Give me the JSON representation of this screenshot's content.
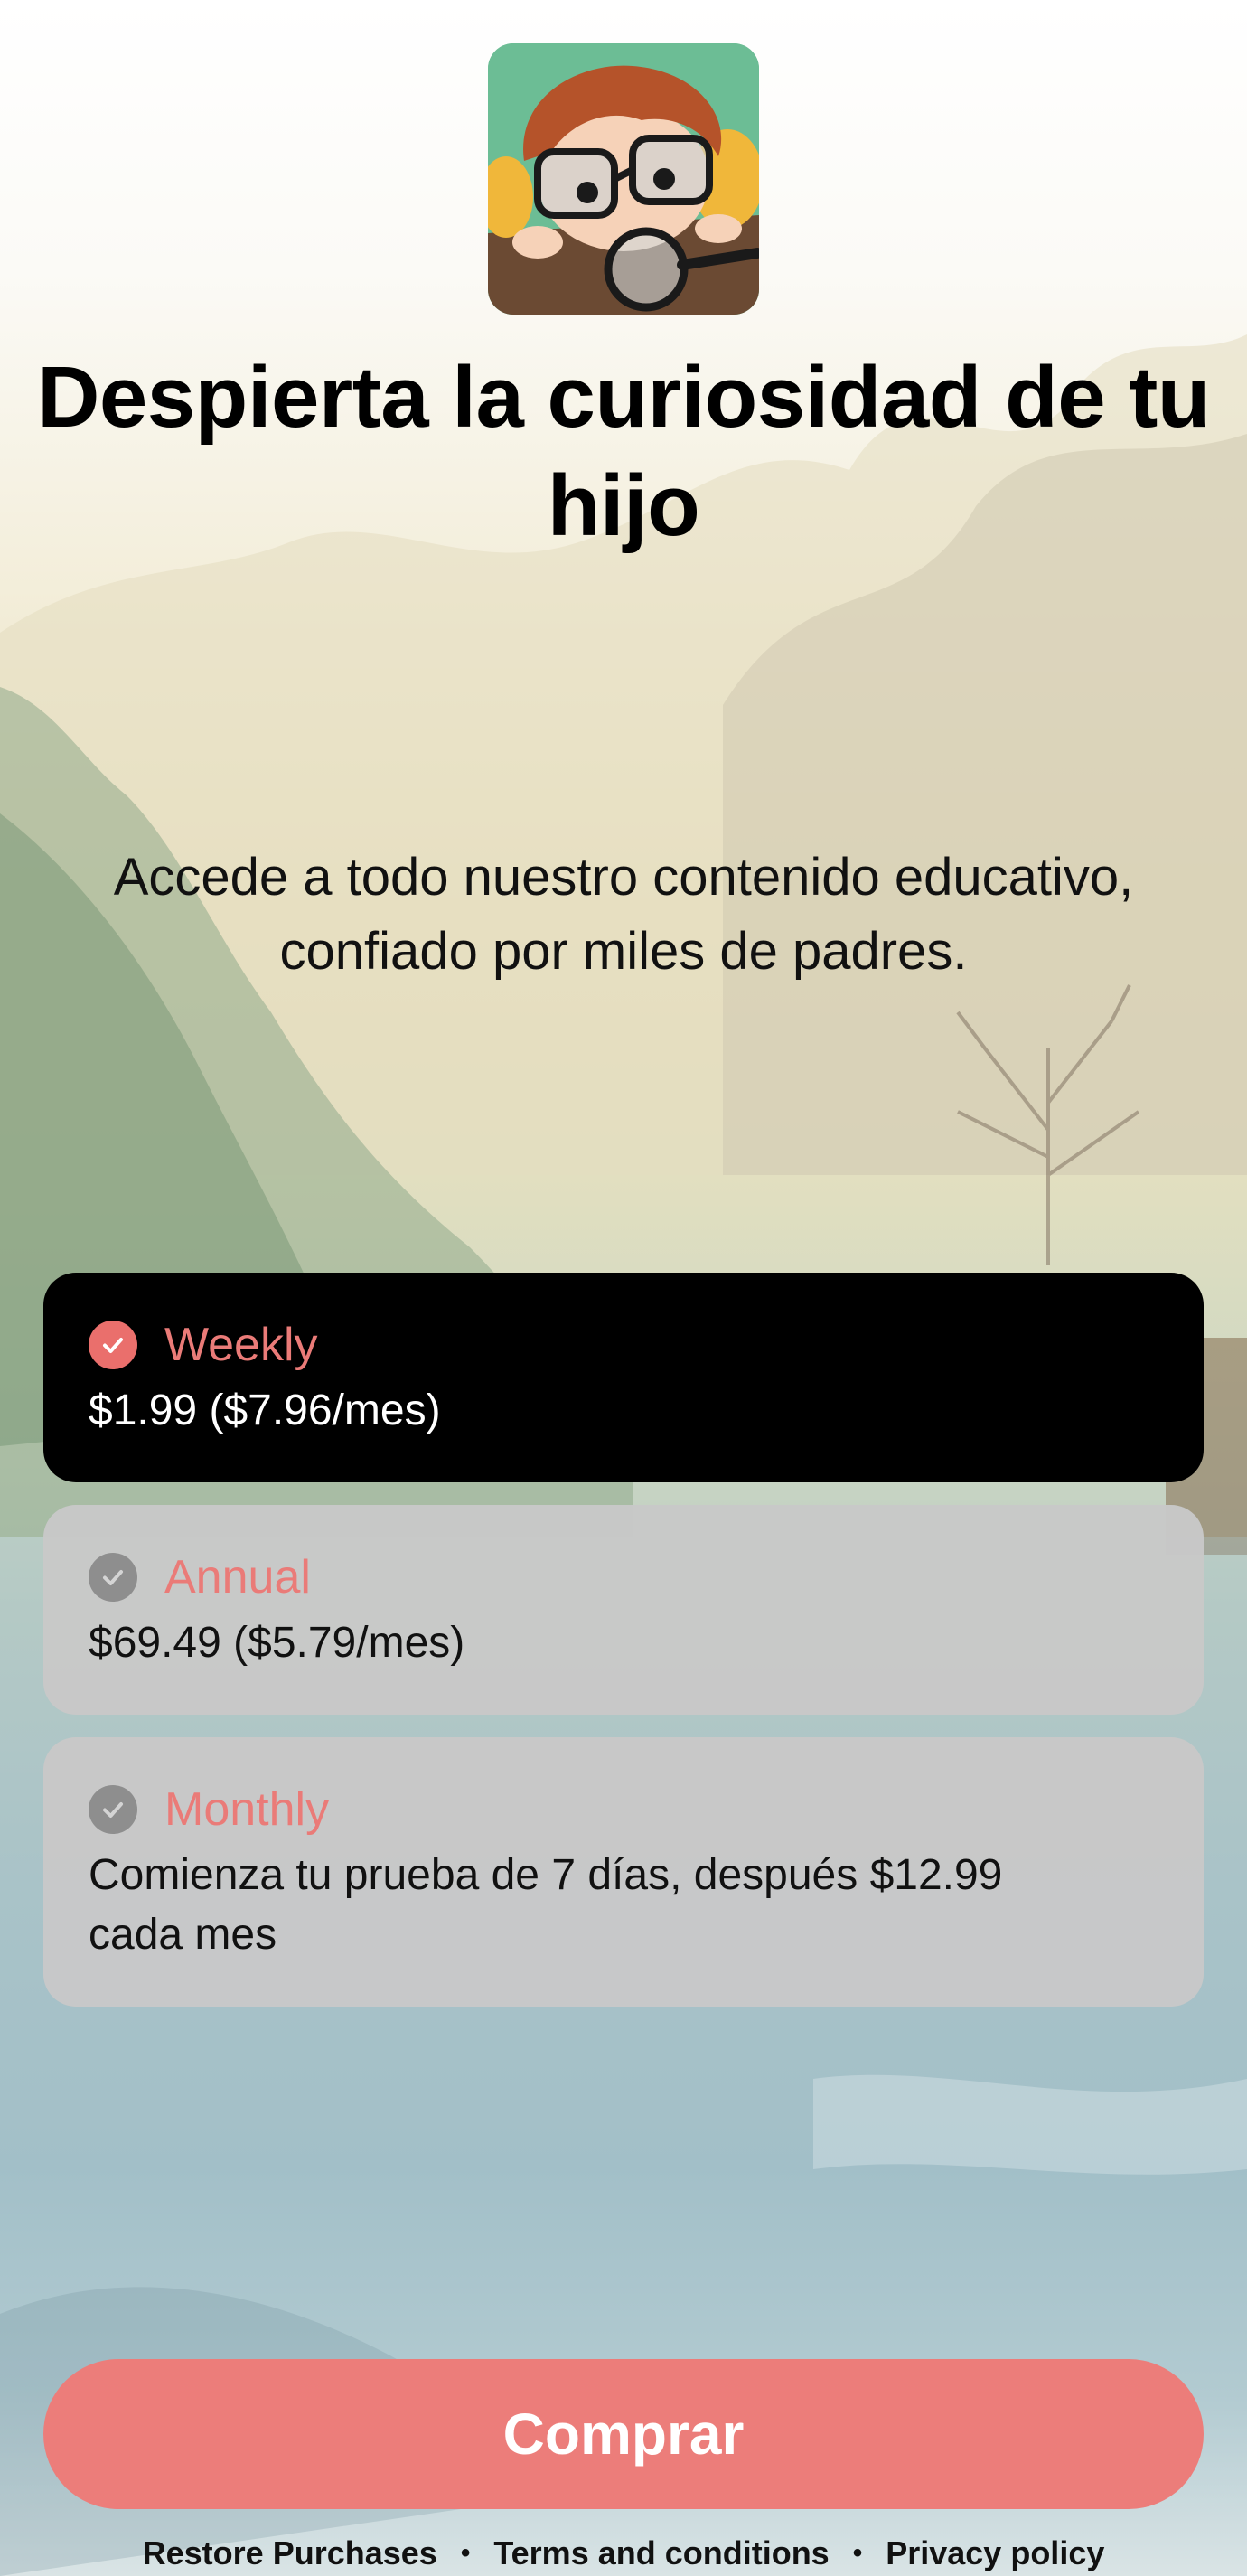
{
  "title": "Despierta la curiosidad de tu hijo",
  "subtitle": "Accede a todo nuestro contenido educativo, confiado por miles de padres.",
  "plans": [
    {
      "name": "Weekly",
      "price": "$1.99 ($7.96/mes)",
      "selected": true
    },
    {
      "name": "Annual",
      "price": "$69.49 ($5.79/mes)",
      "selected": false
    },
    {
      "name": "Monthly",
      "price": "Comienza tu prueba de 7 días, después $12.99 cada mes",
      "selected": false
    }
  ],
  "buy_label": "Comprar",
  "footer": {
    "restore": "Restore Purchases",
    "terms": "Terms and conditions",
    "privacy": "Privacy policy",
    "separator": "•"
  },
  "colors": {
    "accent": "#ec7d7a",
    "selected_card": "#000000",
    "unselected_card": "#c8c8c8",
    "check_selected": "#ea6f6c",
    "check_unselected": "#8e8e8e"
  },
  "icons": {
    "app": "child-with-glasses-and-magnifier-icon",
    "check": "checkmark-circle-icon"
  }
}
